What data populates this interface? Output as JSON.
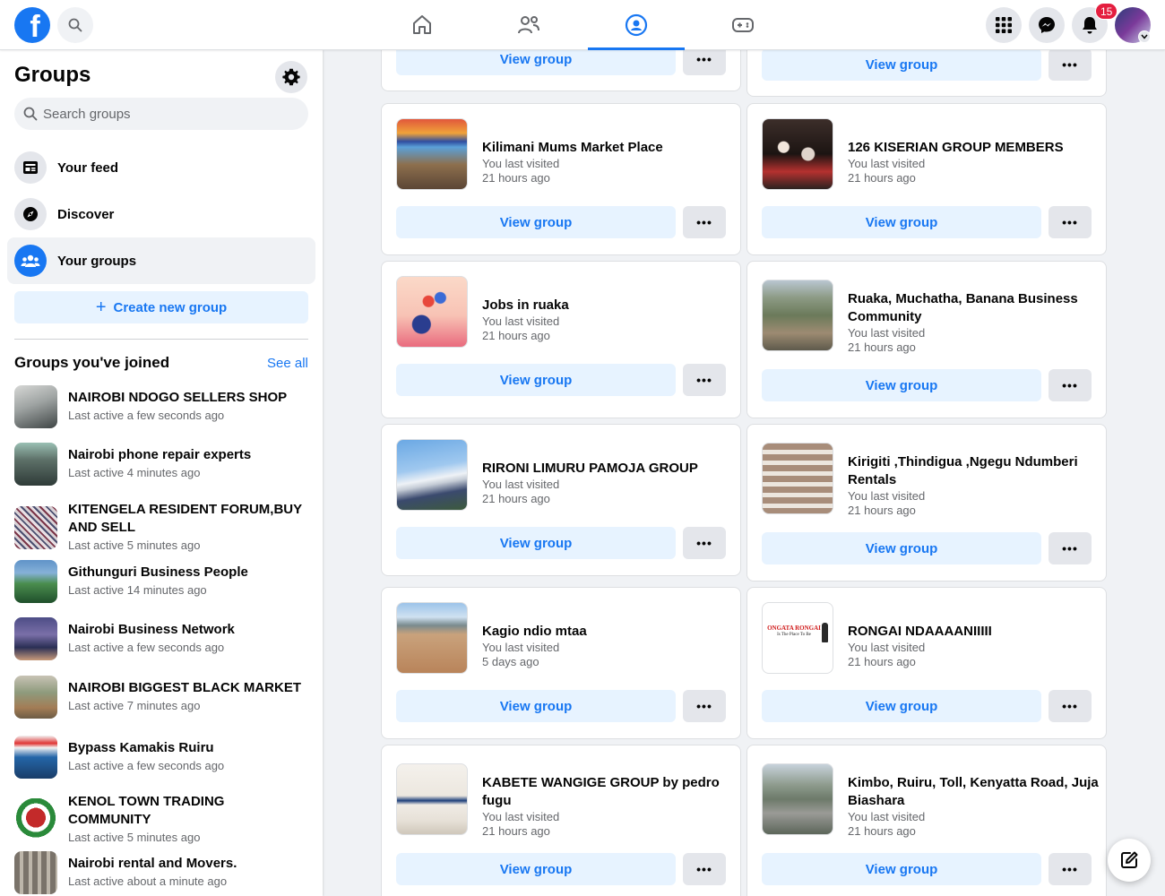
{
  "topbar": {
    "logo_icon": "facebook-logo-icon",
    "notification_count": "15"
  },
  "sidebar": {
    "title": "Groups",
    "search_placeholder": "Search groups",
    "nav_items": [
      {
        "label": "Your feed",
        "icon": "feed-icon"
      },
      {
        "label": "Discover",
        "icon": "compass-icon"
      },
      {
        "label": "Your groups",
        "icon": "groups-icon"
      }
    ],
    "create_label": "Create new group",
    "joined_title": "Groups you've joined",
    "see_all": "See all",
    "joined": [
      {
        "name": "NAIROBI NDOGO SELLERS SHOP",
        "meta": "Last active a few seconds ago"
      },
      {
        "name": "Nairobi phone repair experts",
        "meta": "Last active 4 minutes ago"
      },
      {
        "name": "KITENGELA RESIDENT FORUM,BUY AND SELL",
        "meta": "Last active 5 minutes ago"
      },
      {
        "name": "Githunguri Business People",
        "meta": "Last active 14 minutes ago"
      },
      {
        "name": "Nairobi Business Network",
        "meta": "Last active a few seconds ago"
      },
      {
        "name": "NAIROBI BIGGEST BLACK MARKET",
        "meta": "Last active 7 minutes ago"
      },
      {
        "name": "Bypass Kamakis Ruiru",
        "meta": "Last active a few seconds ago"
      },
      {
        "name": "KENOL TOWN TRADING COMMUNITY",
        "meta": "Last active 5 minutes ago"
      },
      {
        "name": "Nairobi rental and Movers.",
        "meta": "Last active about a minute ago"
      }
    ]
  },
  "main": {
    "view_label": "View group",
    "more_label": "•••",
    "visited_prefix": "You last visited",
    "groups": [
      {
        "name": "Kilimani Mums Market Place",
        "visited": "21 hours ago"
      },
      {
        "name": "126 KISERIAN GROUP MEMBERS",
        "visited": "21 hours ago"
      },
      {
        "name": "Jobs in ruaka",
        "visited": "21 hours ago"
      },
      {
        "name": "Ruaka, Muchatha, Banana Business Community",
        "visited": "21 hours ago"
      },
      {
        "name": "RIRONI LIMURU PAMOJA GROUP",
        "visited": "21 hours ago"
      },
      {
        "name": "Kirigiti ,Thindigua ,Ngegu Ndumberi Rentals",
        "visited": "21 hours ago"
      },
      {
        "name": "Kagio ndio mtaa",
        "visited": "5 days ago"
      },
      {
        "name": "RONGAI NDAAAANIIIII",
        "visited": "21 hours ago"
      },
      {
        "name": "KABETE WANGIGE GROUP by pedro fugu",
        "visited": "21 hours ago"
      },
      {
        "name": "Kimbo, Ruiru, Toll, Kenyatta Road, Juja Biashara",
        "visited": "21 hours ago"
      }
    ],
    "rongai_logo_text": "ONGATA RONGAI",
    "rongai_logo_sub": "Is The Place To Be"
  }
}
